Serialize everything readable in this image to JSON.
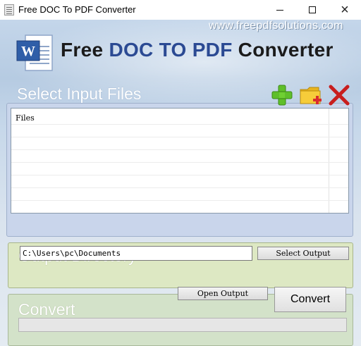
{
  "window": {
    "title": "Free DOC To PDF Converter",
    "icon": "document-icon",
    "controls": {
      "minimize": "minimize-icon",
      "maximize": "maximize-icon",
      "close": "×"
    }
  },
  "header": {
    "website": "www.freepdfsolutions.com",
    "title_part1": "Free ",
    "title_part2": "DOC TO PDF",
    "title_part3": " Converter",
    "logo": "word-document-logo",
    "colors": {
      "dark": "#1b1b1b",
      "blue": "#2b4a93",
      "accent_green": "#5fbf2a",
      "accent_red": "#cc2222",
      "folder_yellow": "#f1c232"
    }
  },
  "input_section": {
    "title": "Select Input Files",
    "toolbar": {
      "add": "plus-icon",
      "add_folder": "folder-add-icon",
      "remove": "red-x-icon"
    },
    "file_list": {
      "header": "Files",
      "items": []
    }
  },
  "output_section": {
    "title": "Output Directory",
    "path": "C:\\Users\\pc\\Documents",
    "select_button": "Select Output",
    "open_button": "Open Output"
  },
  "convert_section": {
    "title": "Convert",
    "button": "Convert",
    "progress": 0
  }
}
